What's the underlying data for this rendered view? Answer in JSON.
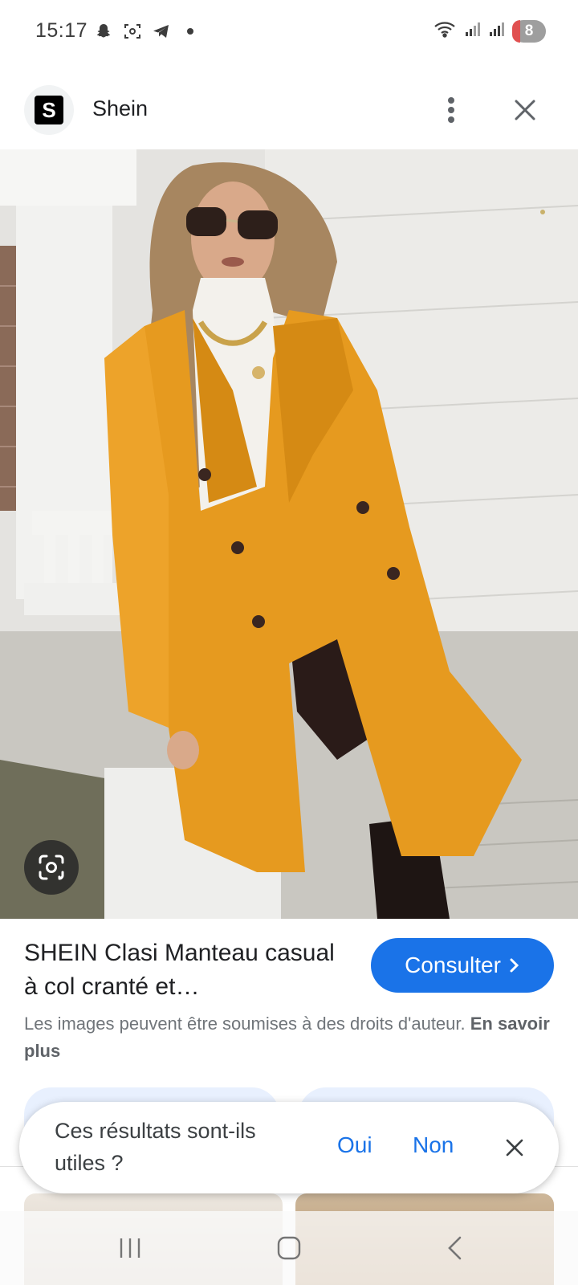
{
  "status_bar": {
    "time": "15:17",
    "left_icons": [
      "snapchat-icon",
      "screenshot-icon",
      "telegram-icon",
      "dot-icon"
    ],
    "right_icons": [
      "wifi-icon",
      "signal-icon",
      "signal-icon"
    ],
    "battery": "8"
  },
  "header": {
    "site_logo": "S",
    "site_name": "Shein"
  },
  "result": {
    "title": "SHEIN Clasi Manteau casual à col cranté et…",
    "visit_label": "Consulter",
    "copyright": "Les images peuvent être soumises à des droits d'auteur.",
    "learn_more": "En savoir plus"
  },
  "feedback": {
    "question": "Ces résultats sont-ils utiles ?",
    "yes": "Oui",
    "no": "Non"
  },
  "colors": {
    "accent": "#1a73e8",
    "coat": "#e69a1f",
    "text": "#202124",
    "muted": "#70757a"
  }
}
